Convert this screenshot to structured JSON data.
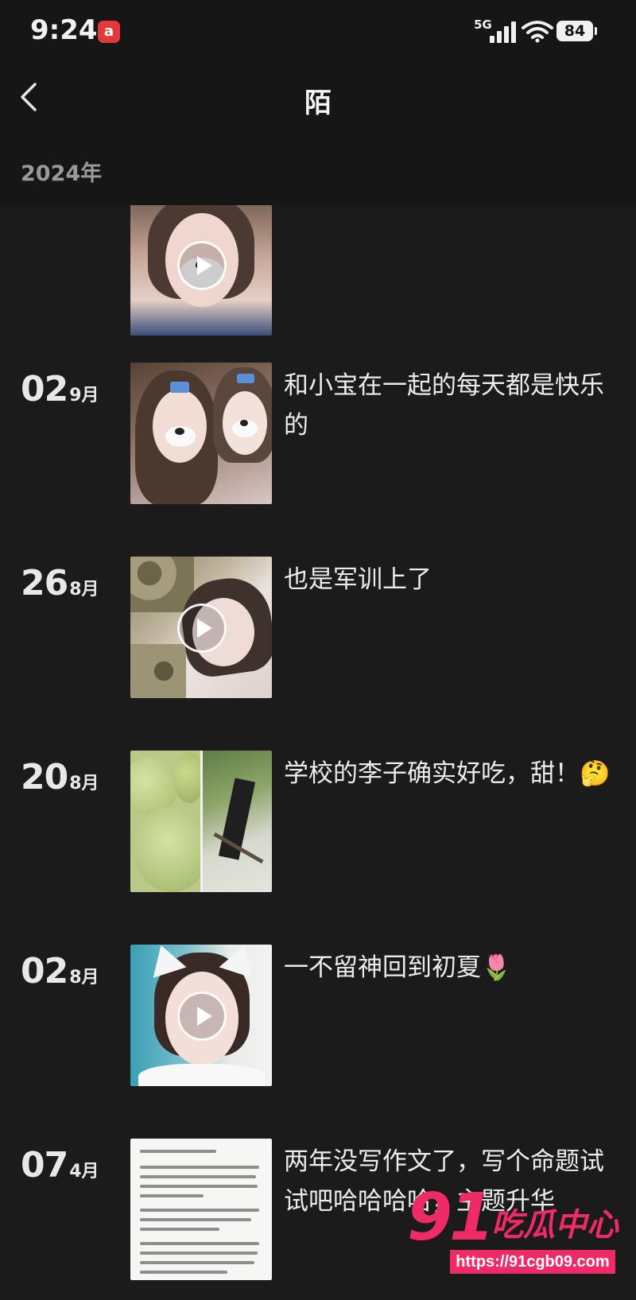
{
  "status_bar": {
    "time": "9:24",
    "network": "5G",
    "battery": "84",
    "app_badge": "a"
  },
  "header": {
    "back_icon": "chevron-left-icon",
    "title": "陌",
    "year": "2024年"
  },
  "posts": [
    {
      "day": "",
      "month": "",
      "caption": "",
      "media": "video"
    },
    {
      "day": "02",
      "month": "9月",
      "caption": "和小宝在一起的每天都是快乐的",
      "media": "photo"
    },
    {
      "day": "26",
      "month": "8月",
      "caption": "也是军训上了",
      "media": "video"
    },
    {
      "day": "20",
      "month": "8月",
      "caption": "学校的李子确实好吃，甜！🤔",
      "media": "photo"
    },
    {
      "day": "02",
      "month": "8月",
      "caption": "一不留神回到初夏🌷",
      "media": "video"
    },
    {
      "day": "07",
      "month": "4月",
      "caption": "两年没写作文了，写个命题试试吧哈哈哈哈，主题升华",
      "media": "document"
    }
  ],
  "watermark": {
    "number": "91",
    "text": "吃瓜中心",
    "url": "https://91cgb09.com"
  },
  "colors": {
    "background": "#1b1b1b",
    "header": "#161616",
    "watermark": "#ee2b66"
  }
}
